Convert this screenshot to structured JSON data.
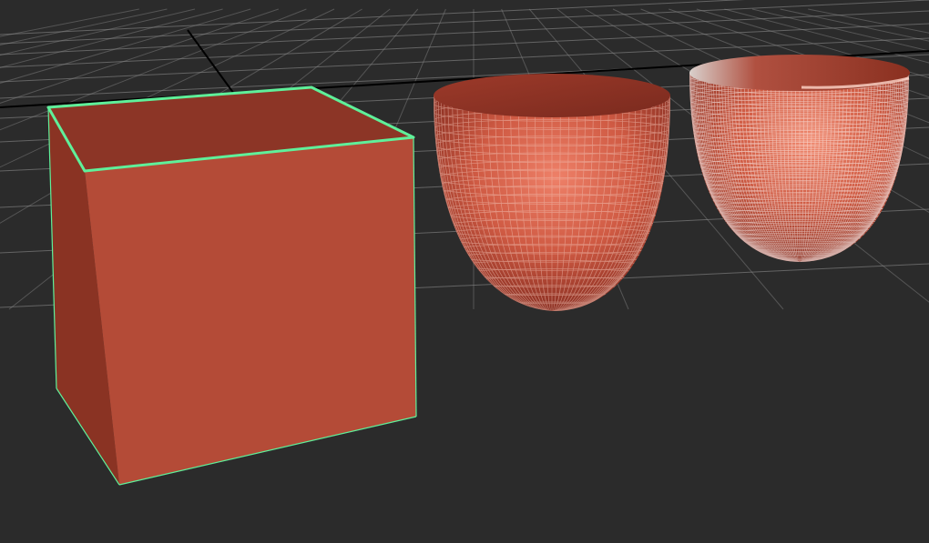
{
  "viewport": {
    "background": "#2b2b2b",
    "grid_color": "#8a8a8a",
    "grid_axis_color": "#000000"
  },
  "objects": [
    {
      "name": "cube",
      "selected": true,
      "selection_color": "#5ff09a",
      "base_color": "#b44b37"
    },
    {
      "name": "bowl-low-subdivision",
      "selected": false,
      "base_color": "#c9553f"
    },
    {
      "name": "bowl-high-subdivision",
      "selected": false,
      "base_color": "#c9553f"
    }
  ]
}
